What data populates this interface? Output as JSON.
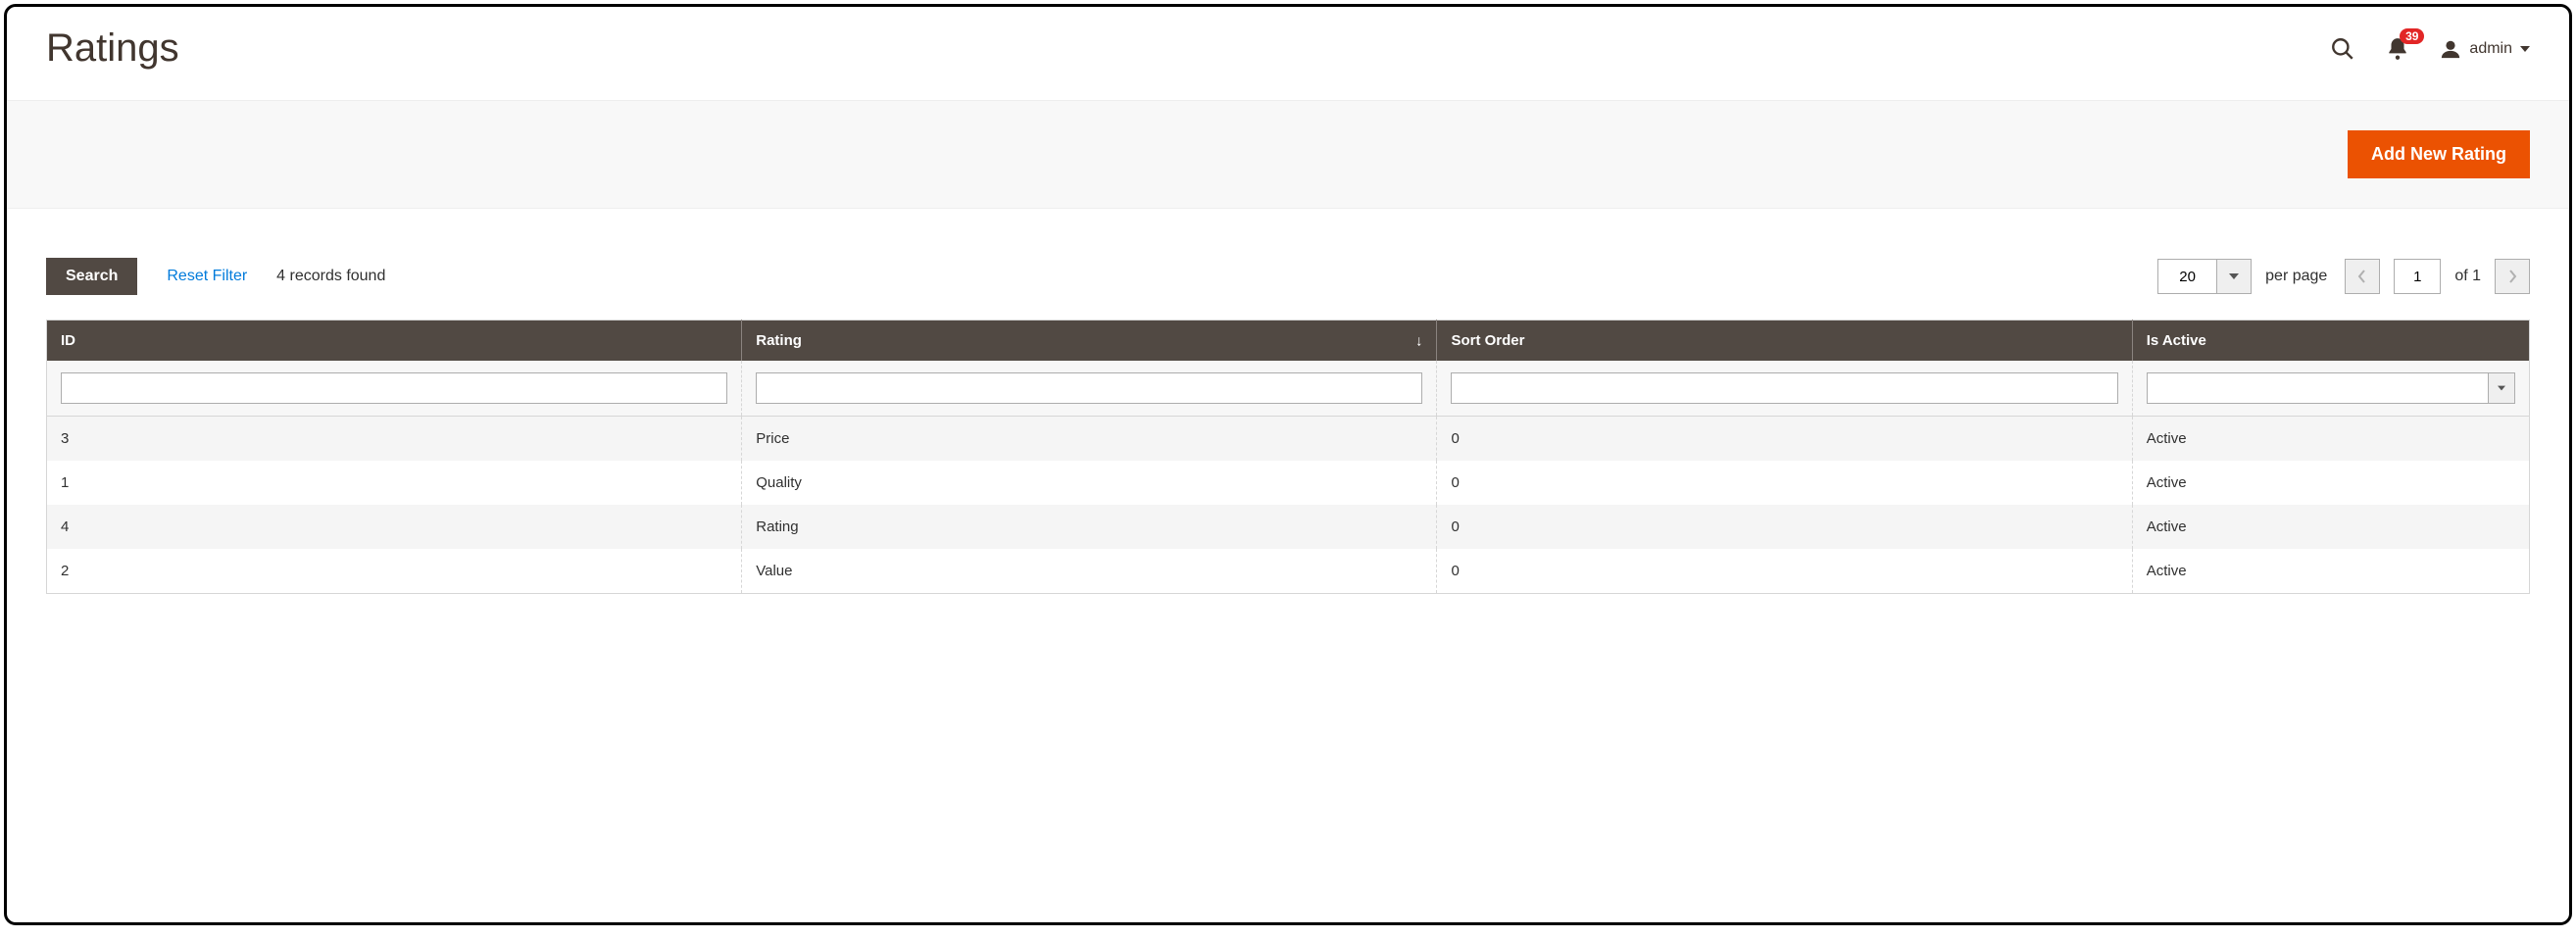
{
  "header": {
    "title": "Ratings",
    "notification_count": "39",
    "username": "admin"
  },
  "toolbar": {
    "add_label": "Add New Rating"
  },
  "grid": {
    "search_label": "Search",
    "reset_label": "Reset Filter",
    "records_found": "4 records found",
    "per_page_value": "20",
    "per_page_label": "per page",
    "page_value": "1",
    "pages_of": "of 1",
    "columns": {
      "id": "ID",
      "rating": "Rating",
      "sort_order": "Sort Order",
      "is_active": "Is Active"
    },
    "sorted_column": "rating",
    "sort_dir": "asc",
    "rows": [
      {
        "id": "3",
        "rating": "Price",
        "sort_order": "0",
        "is_active": "Active"
      },
      {
        "id": "1",
        "rating": "Quality",
        "sort_order": "0",
        "is_active": "Active"
      },
      {
        "id": "4",
        "rating": "Rating",
        "sort_order": "0",
        "is_active": "Active"
      },
      {
        "id": "2",
        "rating": "Value",
        "sort_order": "0",
        "is_active": "Active"
      }
    ]
  }
}
